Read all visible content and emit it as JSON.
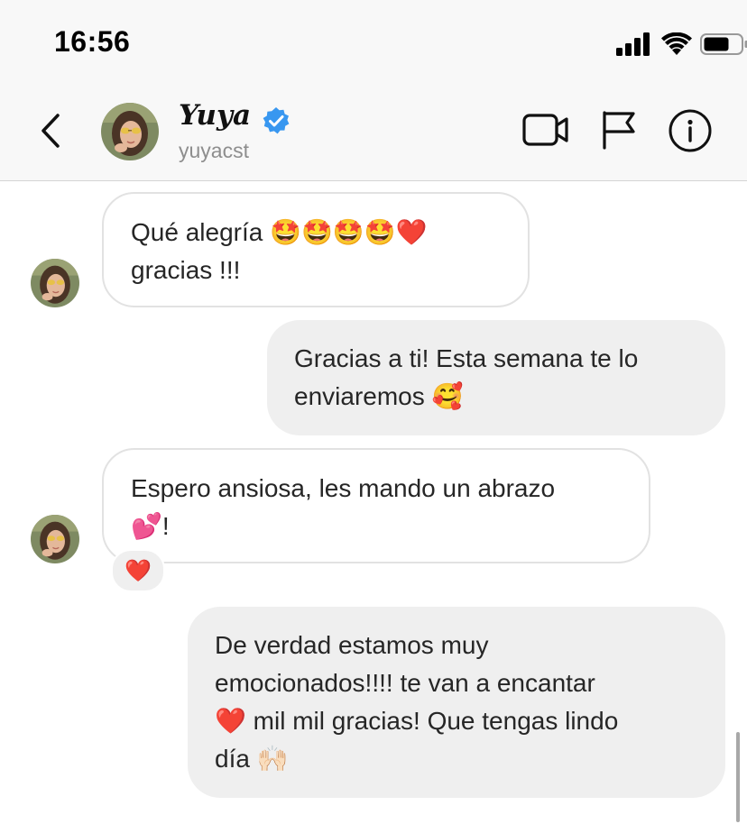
{
  "status_bar": {
    "time": "16:56",
    "icons": [
      "cellular-signal-icon",
      "wifi-icon",
      "battery-icon"
    ]
  },
  "header": {
    "display_name": "Yuya",
    "username": "yuyacst",
    "verified": true,
    "icons": [
      "back-chevron-icon",
      "video-call-icon",
      "flag-icon",
      "info-icon"
    ]
  },
  "messages": [
    {
      "direction": "incoming",
      "lines": [
        {
          "text": "Qué alegría ",
          "emoji": "🤩🤩🤩🤩❤️"
        },
        {
          "text": "gracias !!!",
          "emoji": ""
        }
      ]
    },
    {
      "direction": "outgoing",
      "lines": [
        {
          "text": "Gracias a ti! Esta semana te lo",
          "emoji": ""
        },
        {
          "text": "enviaremos ",
          "emoji": "🥰"
        }
      ]
    },
    {
      "direction": "incoming",
      "lines": [
        {
          "text": "Espero ansiosa, les mando un abrazo",
          "emoji": ""
        },
        {
          "text": "!",
          "emoji": "💕"
        }
      ],
      "reaction": "❤️"
    },
    {
      "direction": "outgoing",
      "lines": [
        {
          "text": "De verdad estamos muy",
          "emoji": ""
        },
        {
          "text": "emocionados!!!! te van a encantar",
          "emoji": ""
        },
        {
          "text": " mil mil gracias! Que tengas lindo",
          "emoji": "❤️"
        },
        {
          "text": "día ",
          "emoji": "🙌🏻"
        }
      ]
    }
  ],
  "colors": {
    "header_background": "#f8f8f8",
    "outgoing_bubble": "#efefef",
    "incoming_border": "#e2e2e2",
    "verified_blue": "#3897f0",
    "username_gray": "#8e8e8e"
  }
}
